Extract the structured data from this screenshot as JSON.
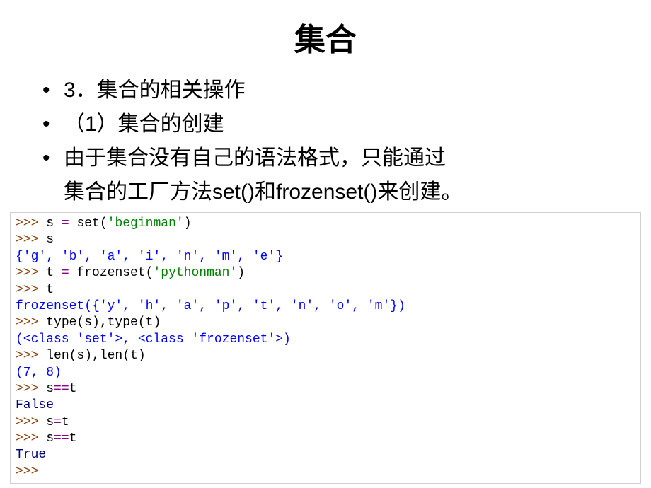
{
  "title": "集合",
  "bullets": {
    "b1": "3．集合的相关操作",
    "b2": "（1）集合的创建",
    "b3_line1": "由于集合没有自己的语法格式，只能通过",
    "b3_line2": "集合的工厂方法set()和frozenset()来创建。"
  },
  "code": {
    "l1_p": ">>> ",
    "l1_a": "s ",
    "l1_b": "= ",
    "l1_c": "set(",
    "l1_d": "'beginman'",
    "l1_e": ")",
    "l2_p": ">>> ",
    "l2_a": "s",
    "l3": "{'g', 'b', 'a', 'i', 'n', 'm', 'e'}",
    "l4_p": ">>> ",
    "l4_a": "t ",
    "l4_b": "= ",
    "l4_c": "frozenset(",
    "l4_d": "'pythonman'",
    "l4_e": ")",
    "l5_p": ">>> ",
    "l5_a": "t",
    "l6": "frozenset({'y', 'h', 'a', 'p', 't', 'n', 'o', 'm'})",
    "l7_p": ">>> ",
    "l7_a": "type(s),type(t)",
    "l8": "(<class 'set'>, <class 'frozenset'>)",
    "l9_p": ">>> ",
    "l9_a": "len(s),len(t)",
    "l10": "(7, 8)",
    "l11_p": ">>> ",
    "l11_a": "s",
    "l11_b": "==",
    "l11_c": "t",
    "l12": "False",
    "l13_p": ">>> ",
    "l13_a": "s",
    "l13_b": "=",
    "l13_c": "t",
    "l14_p": ">>> ",
    "l14_a": "s",
    "l14_b": "==",
    "l14_c": "t",
    "l15": "True",
    "l16_p": ">>> "
  }
}
